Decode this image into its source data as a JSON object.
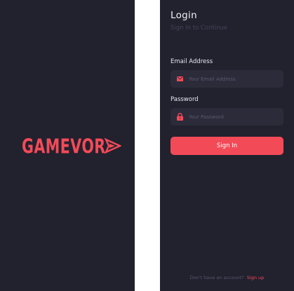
{
  "colors": {
    "panel_bg": "#22212e",
    "field_bg": "#2c2b39",
    "accent": "#f34a58",
    "page_bg": "#ffffff"
  },
  "splash": {
    "logo_text": "GAMEVOR",
    "logo_icon": "chevron-flag-icon"
  },
  "login": {
    "title": "Login",
    "subtitle": "Sign in to Continue",
    "email": {
      "label": "Email Address",
      "placeholder": "Your Email Address",
      "value": "",
      "icon": "envelope-icon"
    },
    "password": {
      "label": "Password",
      "placeholder": "Your Password",
      "value": "",
      "icon": "lock-icon"
    },
    "signin_label": "Sign In",
    "signup_prompt": "Don't have an account?",
    "signup_link": "Sign up"
  }
}
